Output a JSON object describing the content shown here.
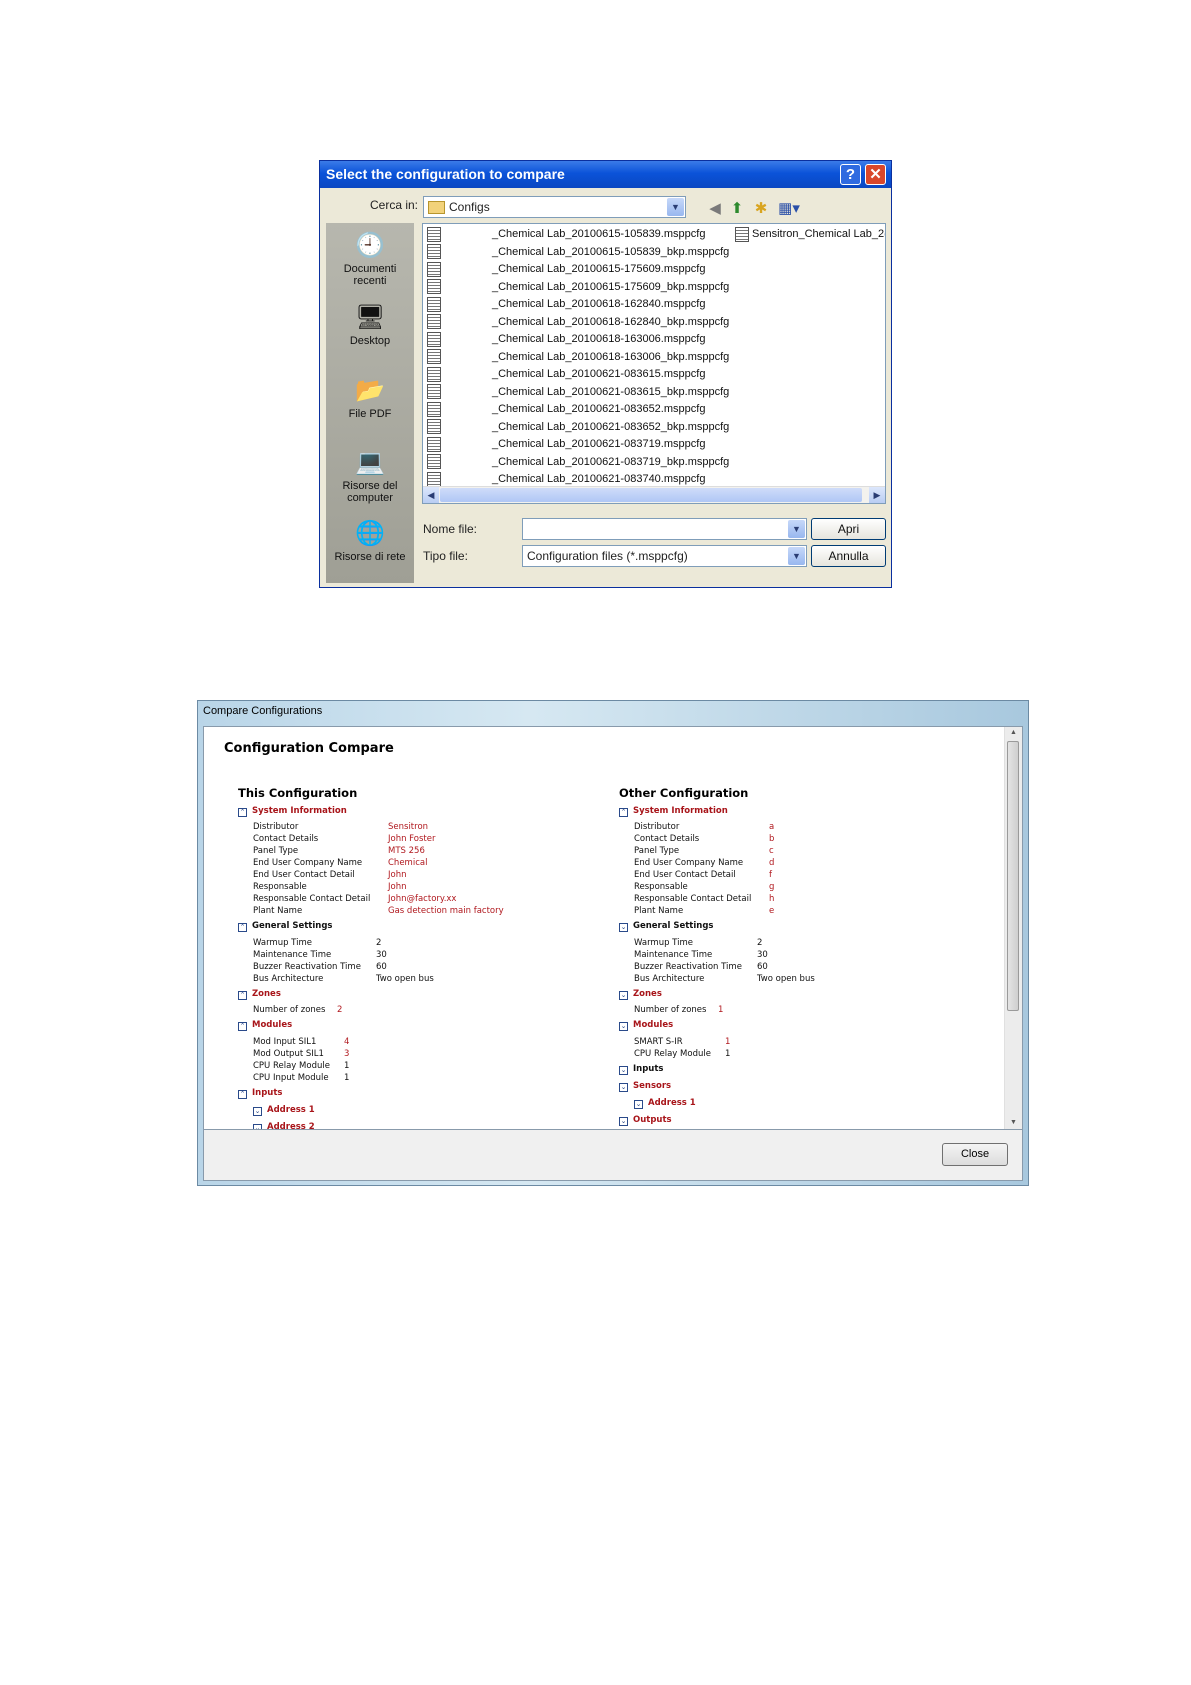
{
  "file_dialog": {
    "title": "Select the configuration to compare",
    "help_glyph": "?",
    "close_glyph": "✕",
    "look_in_label": "Cerca in:",
    "look_in_value": "Configs",
    "toolbar_icons": [
      "back-icon",
      "up-folder-icon",
      "new-folder-icon",
      "view-menu-icon"
    ],
    "places": [
      {
        "label": "Documenti recenti",
        "icon": "recent-documents-icon"
      },
      {
        "label": "Desktop",
        "icon": "desktop-icon"
      },
      {
        "label": "File PDF",
        "icon": "folder-icon"
      },
      {
        "label": "Risorse del computer",
        "icon": "my-computer-icon"
      },
      {
        "label": "Risorse di rete",
        "icon": "network-icon"
      }
    ],
    "files": [
      "_Chemical Lab_20100615-105839.msppcfg",
      "_Chemical Lab_20100615-105839_bkp.msppcfg",
      "_Chemical Lab_20100615-175609.msppcfg",
      "_Chemical Lab_20100615-175609_bkp.msppcfg",
      "_Chemical Lab_20100618-162840.msppcfg",
      "_Chemical Lab_20100618-162840_bkp.msppcfg",
      "_Chemical Lab_20100618-163006.msppcfg",
      "_Chemical Lab_20100618-163006_bkp.msppcfg",
      "_Chemical Lab_20100621-083615.msppcfg",
      "_Chemical Lab_20100621-083615_bkp.msppcfg",
      "_Chemical Lab_20100621-083652.msppcfg",
      "_Chemical Lab_20100621-083652_bkp.msppcfg",
      "_Chemical Lab_20100621-083719.msppcfg",
      "_Chemical Lab_20100621-083719_bkp.msppcfg",
      "_Chemical Lab_20100621-083740.msppcfg"
    ],
    "second_column_file": "Sensitron_Chemical Lab_2(",
    "file_name_label": "Nome file:",
    "file_name_value": "",
    "file_type_label": "Tipo file:",
    "file_type_value": "Configuration files (*.msppcfg)",
    "open_button": "Apri",
    "cancel_button": "Annulla"
  },
  "compare_window": {
    "window_title": "Compare Configurations",
    "heading": "Configuration Compare",
    "close_button": "Close",
    "this_config": {
      "title": "This Configuration",
      "system_information": "System Information",
      "sys_rows": [
        {
          "k": "Distributor",
          "v": "Sensitron"
        },
        {
          "k": "Contact Details",
          "v": "John Foster"
        },
        {
          "k": "Panel Type",
          "v": "MTS 256"
        },
        {
          "k": "End User Company Name",
          "v": "Chemical"
        },
        {
          "k": "End User Contact Detail",
          "v": "John"
        },
        {
          "k": "Responsable",
          "v": "John"
        },
        {
          "k": "Responsable Contact Detail",
          "v": "John@factory.xx"
        },
        {
          "k": "Plant Name",
          "v": "Gas detection main factory"
        }
      ],
      "general_settings": "General Settings",
      "gen_rows": [
        {
          "k": "Warmup Time",
          "v": "2"
        },
        {
          "k": "Maintenance Time",
          "v": "30"
        },
        {
          "k": "Buzzer Reactivation Time",
          "v": "60"
        },
        {
          "k": "Bus Architecture",
          "v": "Two open bus"
        }
      ],
      "zones": "Zones",
      "zones_row": {
        "k": "Number of zones",
        "v": "2"
      },
      "modules": "Modules",
      "mod_rows": [
        {
          "k": "Mod Input SIL1",
          "v": "4"
        },
        {
          "k": "Mod Output SIL1",
          "v": "3"
        },
        {
          "k": "CPU Relay Module",
          "v": "1"
        },
        {
          "k": "CPU Input Module",
          "v": "1"
        }
      ],
      "inputs": "Inputs",
      "address_1": "Address 1",
      "address_2": "Address 2"
    },
    "other_config": {
      "title": "Other Configuration",
      "system_information": "System Information",
      "sys_rows": [
        {
          "k": "Distributor",
          "v": "a"
        },
        {
          "k": "Contact Details",
          "v": "b"
        },
        {
          "k": "Panel Type",
          "v": "c"
        },
        {
          "k": "End User Company Name",
          "v": "d"
        },
        {
          "k": "End User Contact Detail",
          "v": "f"
        },
        {
          "k": "Responsable",
          "v": "g"
        },
        {
          "k": "Responsable Contact Detail",
          "v": "h"
        },
        {
          "k": "Plant Name",
          "v": "e"
        }
      ],
      "general_settings": "General Settings",
      "gen_rows": [
        {
          "k": "Warmup Time",
          "v": "2"
        },
        {
          "k": "Maintenance Time",
          "v": "30"
        },
        {
          "k": "Buzzer Reactivation Time",
          "v": "60"
        },
        {
          "k": "Bus Architecture",
          "v": "Two open bus"
        }
      ],
      "zones": "Zones",
      "zones_row": {
        "k": "Number of zones",
        "v": "1"
      },
      "modules": "Modules",
      "mod_rows": [
        {
          "k": "SMART S-IR",
          "v": "1"
        },
        {
          "k": "CPU Relay Module",
          "v": "1"
        }
      ],
      "inputs": "Inputs",
      "sensors": "Sensors",
      "address_1": "Address 1",
      "outputs": "Outputs"
    },
    "colors": {
      "diff": "#b0181e",
      "xp_title": "#0b53d9"
    }
  }
}
